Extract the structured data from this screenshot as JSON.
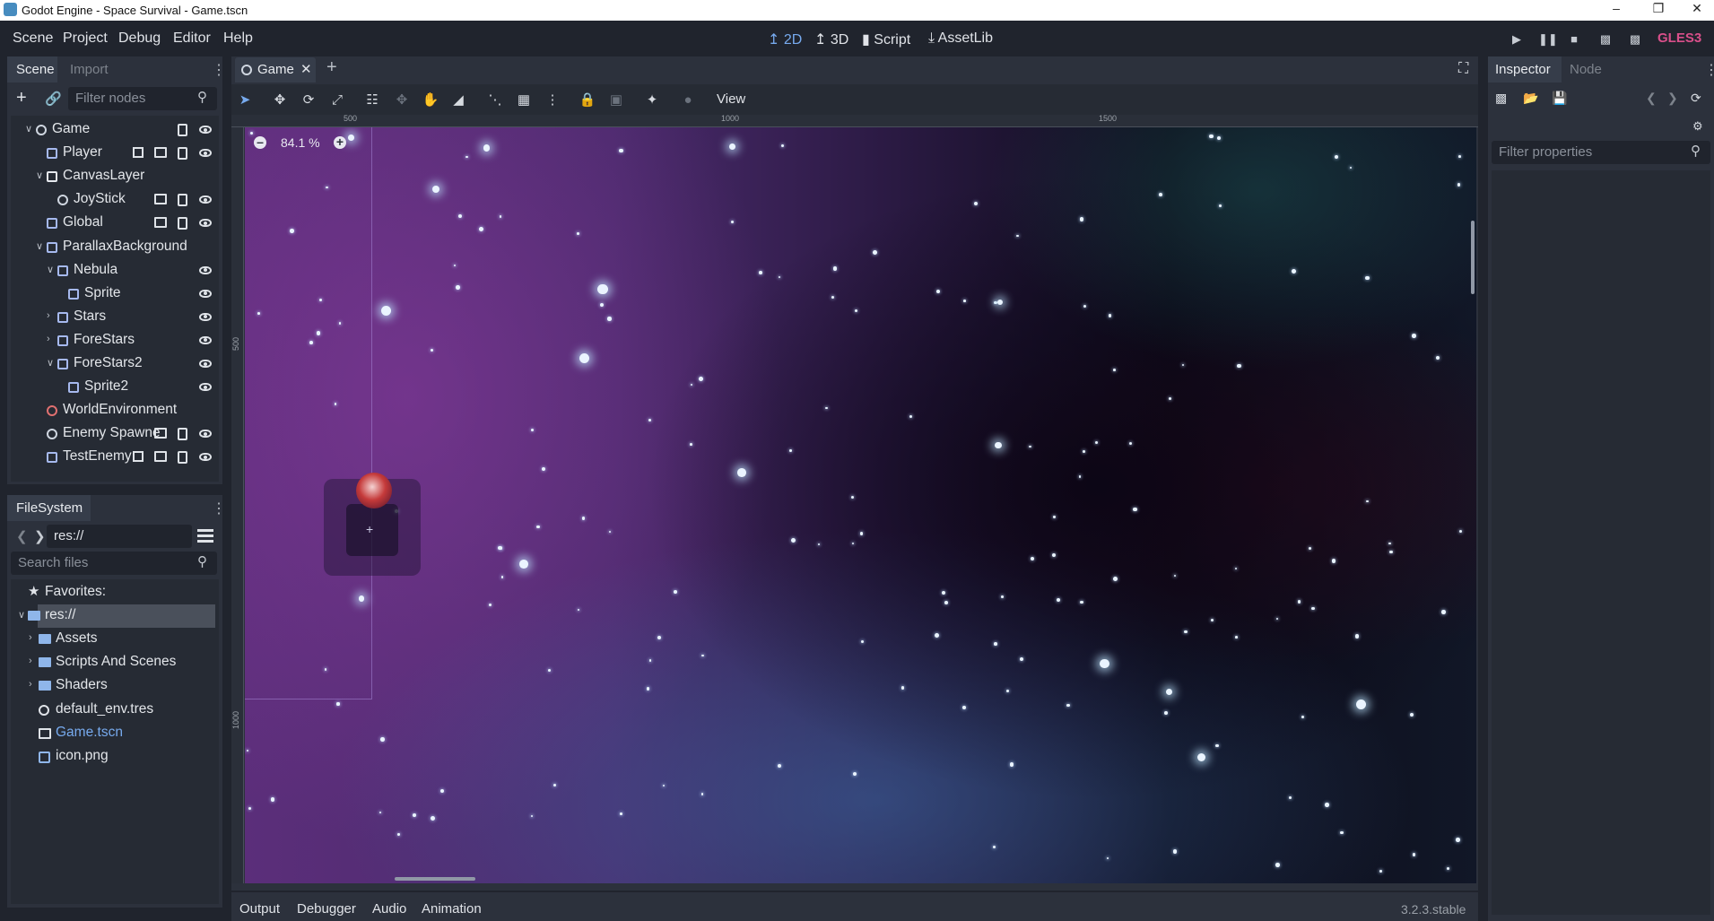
{
  "window": {
    "title": "Godot Engine - Space Survival - Game.tscn"
  },
  "menu": [
    "Scene",
    "Project",
    "Debug",
    "Editor",
    "Help"
  ],
  "workspaces": [
    {
      "label": "2D",
      "icon": "2d-icon",
      "active": true
    },
    {
      "label": "3D",
      "icon": "3d-icon",
      "active": false
    },
    {
      "label": "Script",
      "icon": "script-icon",
      "active": false
    },
    {
      "label": "AssetLib",
      "icon": "assetlib-icon",
      "active": false
    }
  ],
  "renderer": "GLES3",
  "scene_dock": {
    "tabs": [
      "Scene",
      "Import"
    ],
    "filter_placeholder": "Filter nodes",
    "nodes": [
      {
        "name": "Game",
        "indent": 0,
        "arrow": "down",
        "icon": "node2d-icon",
        "script": true,
        "visible": true
      },
      {
        "name": "Player",
        "indent": 1,
        "arrow": "",
        "icon": "kinematic-body-icon",
        "group": true,
        "instance": true,
        "script": true,
        "visible": true
      },
      {
        "name": "CanvasLayer",
        "indent": 1,
        "arrow": "down",
        "icon": "canvas-layer-icon"
      },
      {
        "name": "JoyStick",
        "indent": 2,
        "arrow": "",
        "icon": "node2d-icon",
        "instance": true,
        "script": true,
        "visible": true
      },
      {
        "name": "Global",
        "indent": 1,
        "arrow": "",
        "icon": "global-icon",
        "instance": true,
        "script": true,
        "visible": true
      },
      {
        "name": "ParallaxBackground",
        "indent": 1,
        "arrow": "down",
        "icon": "parallax-background-icon"
      },
      {
        "name": "Nebula",
        "indent": 2,
        "arrow": "down",
        "icon": "parallax-layer-icon",
        "visible": true
      },
      {
        "name": "Sprite",
        "indent": 3,
        "arrow": "",
        "icon": "sprite-icon",
        "visible": true
      },
      {
        "name": "Stars",
        "indent": 2,
        "arrow": "right",
        "icon": "parallax-layer-icon",
        "visible": true
      },
      {
        "name": "ForeStars",
        "indent": 2,
        "arrow": "right",
        "icon": "parallax-layer-icon",
        "visible": true
      },
      {
        "name": "ForeStars2",
        "indent": 2,
        "arrow": "down",
        "icon": "parallax-layer-icon",
        "visible": true
      },
      {
        "name": "Sprite2",
        "indent": 3,
        "arrow": "",
        "icon": "sprite-icon",
        "visible": true
      },
      {
        "name": "WorldEnvironment",
        "indent": 1,
        "arrow": "",
        "icon": "world-environment-icon"
      },
      {
        "name": "Enemy Spawne",
        "indent": 1,
        "arrow": "",
        "icon": "node2d-icon",
        "instance": true,
        "script": true,
        "visible": true
      },
      {
        "name": "TestEnemy",
        "indent": 1,
        "arrow": "",
        "icon": "kinematic-body-icon",
        "group": true,
        "instance": true,
        "script": true,
        "visible": true
      }
    ]
  },
  "filesystem": {
    "tab": "FileSystem",
    "path": "res://",
    "search_placeholder": "Search files",
    "items": [
      {
        "name": "Favorites:",
        "indent": 0,
        "icon": "star-icon",
        "arrow": ""
      },
      {
        "name": "res://",
        "indent": 0,
        "icon": "folder-icon",
        "arrow": "down",
        "selected": true
      },
      {
        "name": "Assets",
        "indent": 1,
        "icon": "folder-icon",
        "arrow": "right"
      },
      {
        "name": "Scripts And Scenes",
        "indent": 1,
        "icon": "folder-icon",
        "arrow": "right"
      },
      {
        "name": "Shaders",
        "indent": 1,
        "icon": "folder-icon",
        "arrow": "right"
      },
      {
        "name": "default_env.tres",
        "indent": 1,
        "icon": "environment-icon",
        "arrow": ""
      },
      {
        "name": "Game.tscn",
        "indent": 1,
        "icon": "scene-icon",
        "arrow": "",
        "highlight": true
      },
      {
        "name": "icon.png",
        "indent": 1,
        "icon": "image-icon",
        "arrow": ""
      }
    ]
  },
  "editor": {
    "tab": "Game",
    "view_menu": "View",
    "zoom": "84.1 %",
    "ruler_top": [
      "500",
      "1000",
      "1500"
    ],
    "ruler_left": [
      "500",
      "1000"
    ]
  },
  "bottom_tabs": [
    "Output",
    "Debugger",
    "Audio",
    "Animation"
  ],
  "version": "3.2.3.stable",
  "inspector": {
    "tabs": [
      "Inspector",
      "Node"
    ],
    "filter_placeholder": "Filter properties"
  }
}
